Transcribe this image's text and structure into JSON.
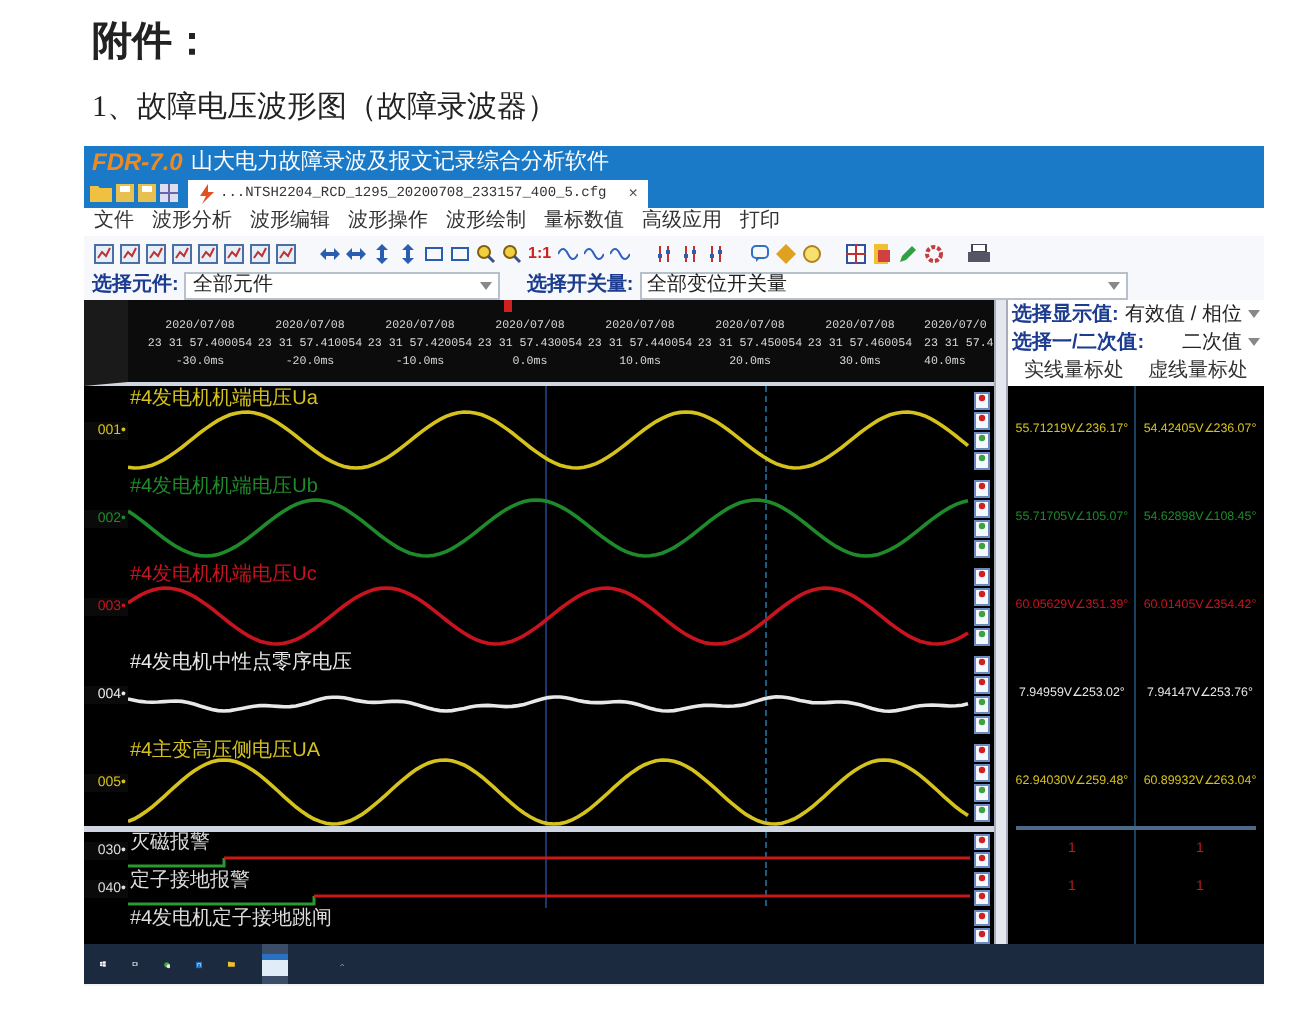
{
  "heading": "附件：",
  "caption": "1、故障电压波形图（故障录波器）",
  "window": {
    "logo": "FDR-7.0",
    "title": "山大电力故障录波及报文记录综合分析软件"
  },
  "tab": {
    "label": "...NTSH2204_RCD_1295_20200708_233157_400_5.cfg",
    "close": "×",
    "selected": true
  },
  "menu": [
    "文件",
    "波形分析",
    "波形编辑",
    "波形操作",
    "波形绘制",
    "量标数值",
    "高级应用",
    "打印"
  ],
  "toolbar": {
    "ratio_label": "1:1"
  },
  "filters": [
    {
      "label": "选择元件:",
      "value": "全部元件"
    },
    {
      "label": "选择开关量:",
      "value": "全部变位开关量"
    }
  ],
  "panel": {
    "selects": [
      {
        "label": "选择显示值:",
        "value": "有效值 / 相位"
      },
      {
        "label": "选择一/二次值:",
        "value": "二次值"
      }
    ],
    "columns": [
      "实线量标处",
      "虚线量标处"
    ]
  },
  "time_axis": [
    {
      "date": "2020/07/08",
      "time": "23 31 57.400054",
      "offset": "-30.0ms"
    },
    {
      "date": "2020/07/08",
      "time": "23 31 57.410054",
      "offset": "-20.0ms"
    },
    {
      "date": "2020/07/08",
      "time": "23 31 57.420054",
      "offset": "-10.0ms"
    },
    {
      "date": "2020/07/08",
      "time": "23 31 57.430054",
      "offset": "0.0ms"
    },
    {
      "date": "2020/07/08",
      "time": "23 31 57.440054",
      "offset": "10.0ms"
    },
    {
      "date": "2020/07/08",
      "time": "23 31 57.450054",
      "offset": "20.0ms"
    },
    {
      "date": "2020/07/08",
      "time": "23 31 57.460054",
      "offset": "30.0ms"
    },
    {
      "date": "2020/07/0",
      "time": "23 31 57.4",
      "offset": "40.0ms"
    }
  ],
  "analog_channels": [
    {
      "number": "001•",
      "name": "#4发电机机端电压Ua",
      "color": "#d6c21c",
      "solid_value": "55.71219V∠236.17°",
      "dashed_value": "54.42405V∠236.07°"
    },
    {
      "number": "002•",
      "name": "#4发电机机端电压Ub",
      "color": "#1f8a2a",
      "solid_value": "55.71705V∠105.07°",
      "dashed_value": "54.62898V∠108.45°"
    },
    {
      "number": "003•",
      "name": "#4发电机机端电压Uc",
      "color": "#c8141e",
      "solid_value": "60.05629V∠351.39°",
      "dashed_value": "60.01405V∠354.42°"
    },
    {
      "number": "004•",
      "name": "#4发电机中性点零序电压",
      "color": "#e8e8e8",
      "solid_value": "7.94959V∠253.02°",
      "dashed_value": "7.94147V∠253.76°"
    },
    {
      "number": "005•",
      "name": "#4主变高压侧电压UA",
      "color": "#d6c21c",
      "solid_value": "62.94030V∠259.48°",
      "dashed_value": "60.89932V∠263.04°"
    }
  ],
  "digital_channels": [
    {
      "number": "030•",
      "name": "灭磁报警",
      "solid_value": "1",
      "dashed_value": "1"
    },
    {
      "number": "040•",
      "name": "定子接地报警",
      "solid_value": "1",
      "dashed_value": "1"
    },
    {
      "name": "#4发电机定子接地跳闸"
    }
  ]
}
